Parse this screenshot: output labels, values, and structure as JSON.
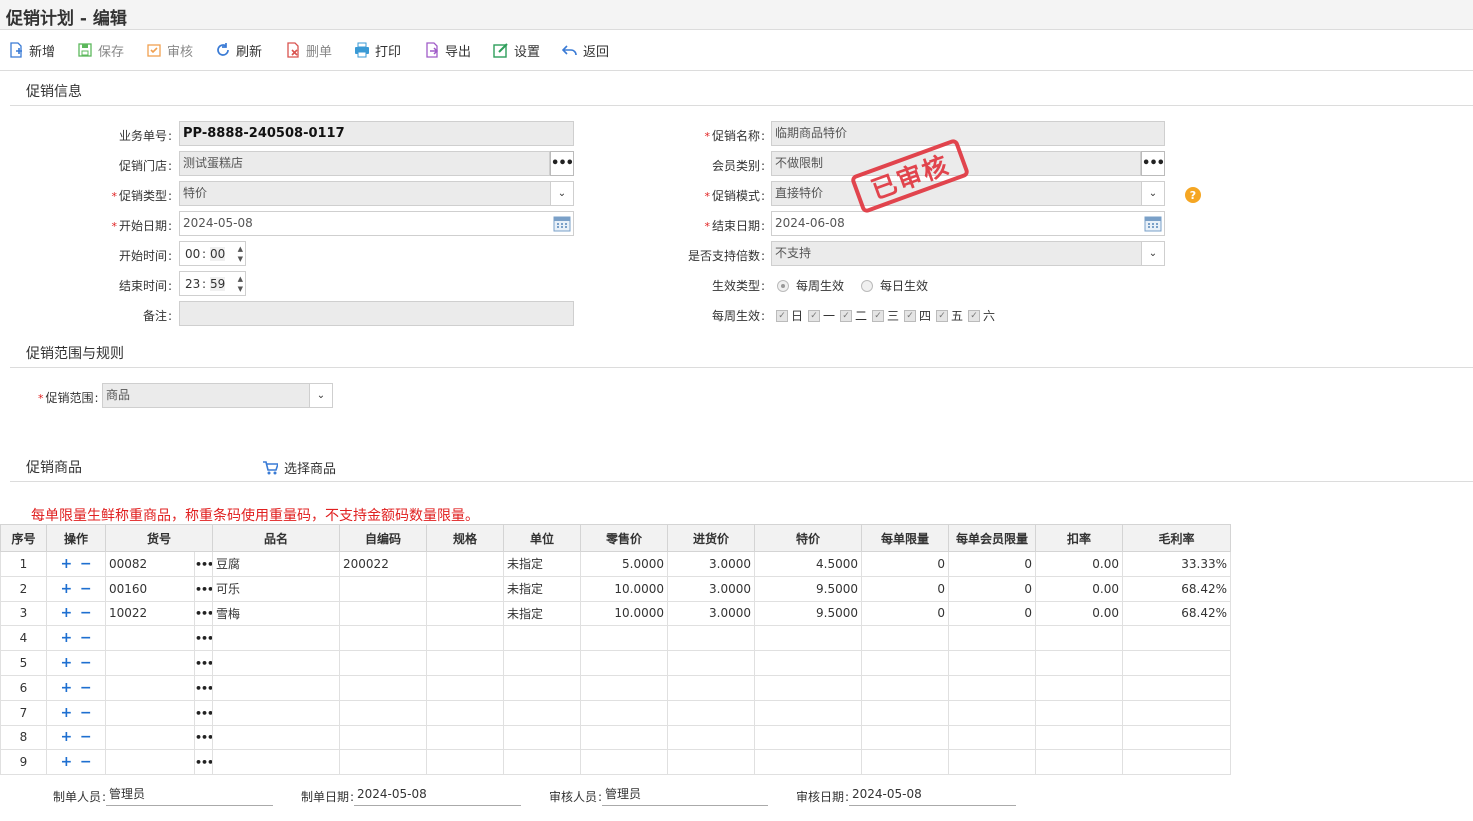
{
  "title": "促销计划 - 编辑",
  "toolbar": [
    {
      "label": "新增",
      "icon": "add-doc-icon",
      "enabled": true
    },
    {
      "label": "保存",
      "icon": "save-icon",
      "enabled": false
    },
    {
      "label": "审核",
      "icon": "audit-icon",
      "enabled": false
    },
    {
      "label": "刷新",
      "icon": "refresh-icon",
      "enabled": true
    },
    {
      "label": "删单",
      "icon": "delete-doc-icon",
      "enabled": false
    },
    {
      "label": "打印",
      "icon": "print-icon",
      "enabled": true
    },
    {
      "label": "导出",
      "icon": "export-icon",
      "enabled": true
    },
    {
      "label": "设置",
      "icon": "settings-icon",
      "enabled": true
    },
    {
      "label": "返回",
      "icon": "back-icon",
      "enabled": true
    }
  ],
  "sections": {
    "info": "促销信息",
    "scope": "促销范围与规则",
    "products": "促销商品",
    "select_products": "选择商品"
  },
  "form": {
    "doc_no_label": "业务单号",
    "doc_no": "PP-8888-240508-0117",
    "name_label": "促销名称",
    "name": "临期商品特价",
    "store_label": "促销门店",
    "store": "测试蛋糕店",
    "member_label": "会员类别",
    "member": "不做限制",
    "type_label": "促销类型",
    "type": "特价",
    "mode_label": "促销模式",
    "mode": "直接特价",
    "start_date_label": "开始日期",
    "start_date": "2024-05-08",
    "end_date_label": "结束日期",
    "end_date": "2024-06-08",
    "start_time_label": "开始时间",
    "start_time_h": "00",
    "start_time_m": "00",
    "end_time_label": "结束时间",
    "end_time_h": "23",
    "end_time_m": "59",
    "multiple_label": "是否支持倍数",
    "multiple": "不支持",
    "remark_label": "备注",
    "remark": "",
    "effect_type_label": "生效类型",
    "effect_weekly": "每周生效",
    "effect_daily": "每日生效",
    "weekly_label": "每周生效",
    "weekdays": [
      "日",
      "一",
      "二",
      "三",
      "四",
      "五",
      "六"
    ],
    "scope_label": "促销范围",
    "scope": "商品"
  },
  "stamp": "已审核",
  "help": "?",
  "warning": "每单限量生鲜称重商品，称重条码使用重量码，不支持金额码数量限量。",
  "table": {
    "headers": [
      "序号",
      "操作",
      "货号",
      "品名",
      "自编码",
      "规格",
      "单位",
      "零售价",
      "进货价",
      "特价",
      "每单限量",
      "每单会员限量",
      "扣率",
      "毛利率"
    ],
    "rows": [
      {
        "no": "1",
        "code": "00082",
        "name": "豆腐",
        "self_code": "200022",
        "spec": "",
        "unit": "未指定",
        "retail": "5.0000",
        "cost": "3.0000",
        "special": "4.5000",
        "limit": "0",
        "member_limit": "0",
        "discount": "0.00",
        "margin": "33.33%"
      },
      {
        "no": "2",
        "code": "00160",
        "name": "可乐",
        "self_code": "",
        "spec": "",
        "unit": "未指定",
        "retail": "10.0000",
        "cost": "3.0000",
        "special": "9.5000",
        "limit": "0",
        "member_limit": "0",
        "discount": "0.00",
        "margin": "68.42%"
      },
      {
        "no": "3",
        "code": "10022",
        "name": "雪梅",
        "self_code": "",
        "spec": "",
        "unit": "未指定",
        "retail": "10.0000",
        "cost": "3.0000",
        "special": "9.5000",
        "limit": "0",
        "member_limit": "0",
        "discount": "0.00",
        "margin": "68.42%"
      },
      {
        "no": "4"
      },
      {
        "no": "5"
      },
      {
        "no": "6"
      },
      {
        "no": "7"
      },
      {
        "no": "8"
      },
      {
        "no": "9"
      }
    ]
  },
  "footer": {
    "maker_label": "制单人员",
    "maker": "管理员",
    "make_date_label": "制单日期",
    "make_date": "2024-05-08",
    "auditor_label": "审核人员",
    "auditor": "管理员",
    "audit_date_label": "审核日期",
    "audit_date": "2024-05-08"
  }
}
